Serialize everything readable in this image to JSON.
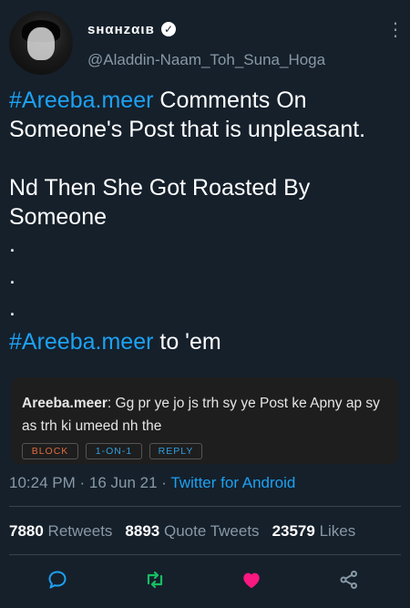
{
  "author": {
    "display_name": "sнαнzαιв",
    "verified_mark": "✓",
    "handle": "@Aladdin-Naam_Toh_Suna_Hoga"
  },
  "tweet": {
    "line1_hashtag": "#Areeba.meer",
    "line1_rest": " Comments On Someone's Post that is unpleasant.",
    "line2": "Nd Then She Got Roasted By Someone",
    "dot": ".",
    "line3_hashtag": "#Areeba.meer",
    "line3_rest": " to 'em"
  },
  "embedded_comment": {
    "author": "Areeba.meer",
    "separator": ": ",
    "text": "Gg pr ye jo js trh sy ye Post ke Apny ap sy as trh ki umeed nh the",
    "buttons": {
      "block": "BLOCK",
      "one_on_one": "1-ON-1",
      "reply": "REPLY"
    }
  },
  "meta": {
    "time": "10:24 PM · 16 Jun 21 · ",
    "source": "Twitter for Android"
  },
  "stats": {
    "retweets_count": "7880",
    "retweets_label": " Retweets",
    "quotes_count": "8893",
    "quotes_label": " Quote Tweets",
    "likes_count": "23579",
    "likes_label": " Likes"
  },
  "actions": {
    "reply_icon": "comment-icon",
    "retweet_icon": "retweet-icon",
    "like_icon": "heart-icon",
    "share_icon": "share-icon"
  },
  "colors": {
    "background": "#15202b",
    "link": "#1da1f2",
    "muted": "#8899a6",
    "retweet": "#17bf63",
    "like": "#f91880"
  }
}
